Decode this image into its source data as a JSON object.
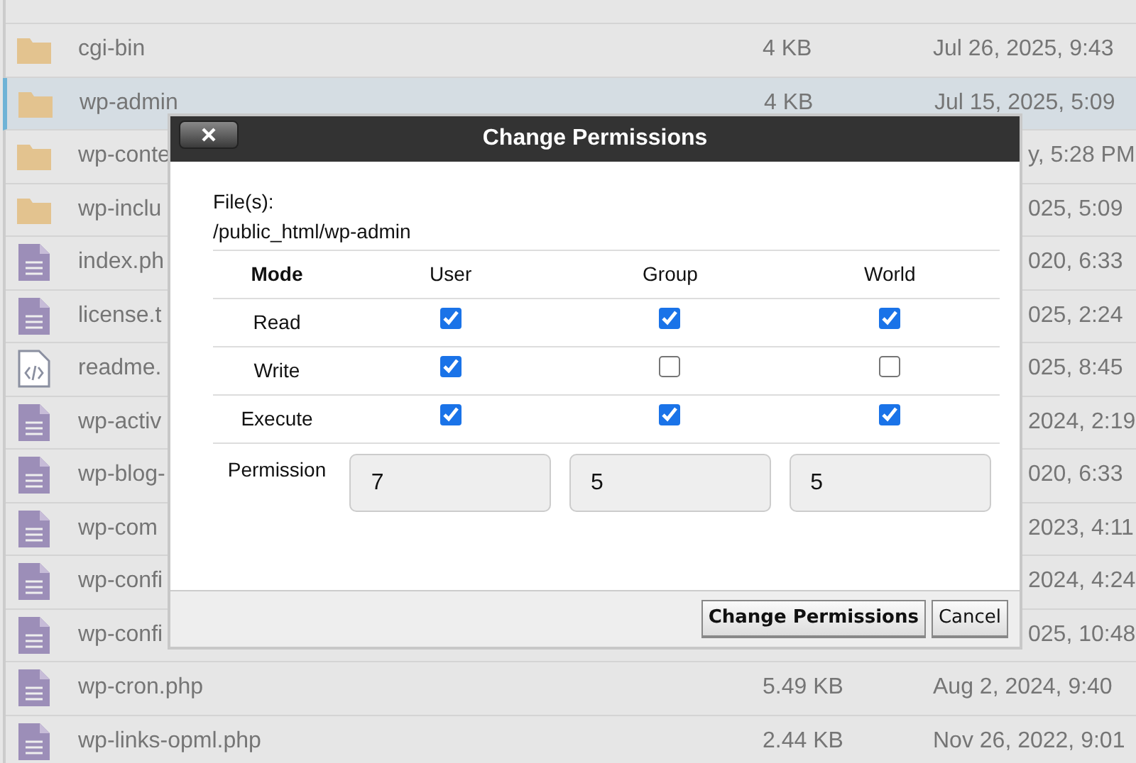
{
  "files": [
    {
      "name": "cgi-bin",
      "size": "4 KB",
      "modified": "Jul 26, 2025, 9:43",
      "kind": "folder",
      "selected": false,
      "under_dialog": false
    },
    {
      "name": "wp-admin",
      "size": "4 KB",
      "modified": "Jul 15, 2025, 5:09",
      "kind": "folder",
      "selected": true,
      "under_dialog": false
    },
    {
      "name": "wp-conte",
      "modified": "y, 5:28 PM",
      "kind": "folder",
      "selected": false,
      "under_dialog": true
    },
    {
      "name": "wp-inclu",
      "modified": "025, 5:09",
      "kind": "folder",
      "selected": false,
      "under_dialog": true
    },
    {
      "name": "index.ph",
      "modified": "020, 6:33",
      "kind": "file",
      "selected": false,
      "under_dialog": true
    },
    {
      "name": "license.t",
      "modified": "025, 2:24",
      "kind": "file",
      "selected": false,
      "under_dialog": true
    },
    {
      "name": "readme.",
      "modified": "025, 8:45",
      "kind": "code",
      "selected": false,
      "under_dialog": true
    },
    {
      "name": "wp-activ",
      "modified": "2024, 2:19",
      "kind": "file",
      "selected": false,
      "under_dialog": true
    },
    {
      "name": "wp-blog-",
      "modified": "020, 6:33",
      "kind": "file",
      "selected": false,
      "under_dialog": true
    },
    {
      "name": "wp-com",
      "modified": "2023, 4:11",
      "kind": "file",
      "selected": false,
      "under_dialog": true
    },
    {
      "name": "wp-confi",
      "modified": "2024, 4:24",
      "kind": "file",
      "selected": false,
      "under_dialog": true
    },
    {
      "name": "wp-confi",
      "modified": "025, 10:48",
      "kind": "file",
      "selected": false,
      "under_dialog": true
    },
    {
      "name": "wp-cron.php",
      "size": "5.49 KB",
      "modified": "Aug 2, 2024, 9:40",
      "kind": "file",
      "selected": false,
      "under_dialog": false
    },
    {
      "name": "wp-links-opml.php",
      "size": "2.44 KB",
      "modified": "Nov 26, 2022, 9:01",
      "kind": "file",
      "selected": false,
      "under_dialog": false
    }
  ],
  "dialog": {
    "title": "Change Permissions",
    "files_label": "File(s):",
    "path": "/public_html/wp-admin",
    "columns": [
      "Mode",
      "User",
      "Group",
      "World"
    ],
    "modes": [
      {
        "label": "Read",
        "user": true,
        "group": true,
        "world": true
      },
      {
        "label": "Write",
        "user": true,
        "group": false,
        "world": false
      },
      {
        "label": "Execute",
        "user": true,
        "group": true,
        "world": true
      }
    ],
    "permission": {
      "label": "Permission",
      "values": [
        "7",
        "5",
        "5"
      ]
    },
    "buttons": [
      {
        "label": "Change Permissions",
        "kind": "primary"
      },
      {
        "label": "Cancel",
        "kind": "cancel"
      }
    ]
  }
}
